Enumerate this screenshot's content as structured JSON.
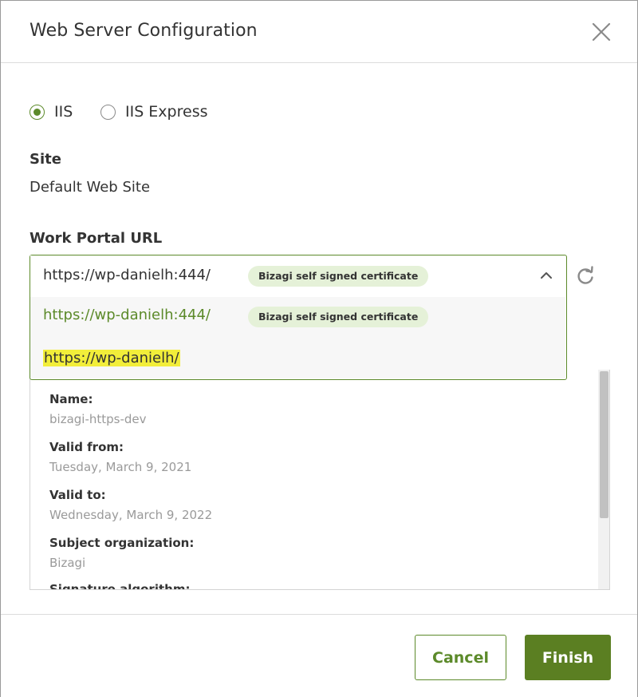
{
  "dialog": {
    "title": "Web Server Configuration"
  },
  "server_type": {
    "options": [
      {
        "label": "IIS",
        "selected": true
      },
      {
        "label": "IIS Express",
        "selected": false
      }
    ]
  },
  "site": {
    "label": "Site",
    "value": "Default Web Site"
  },
  "work_portal": {
    "label": "Work Portal URL",
    "selected_url": "https://wp-danielh:444/",
    "selected_badge": "Bizagi self signed certificate",
    "options": [
      {
        "url": "https://wp-danielh:444/",
        "badge": "Bizagi self signed certificate"
      },
      {
        "url": "https://wp-danielh/",
        "badge": ""
      }
    ]
  },
  "certificate": {
    "fields": [
      {
        "key": "Name:",
        "value": "bizagi-https-dev"
      },
      {
        "key": "Valid from:",
        "value": "Tuesday, March 9, 2021"
      },
      {
        "key": "Valid to:",
        "value": "Wednesday, March 9, 2022"
      },
      {
        "key": "Subject organization:",
        "value": "Bizagi"
      },
      {
        "key": "Signature algorithm:",
        "value": ""
      }
    ]
  },
  "footer": {
    "cancel_label": "Cancel",
    "finish_label": "Finish"
  },
  "colors": {
    "accent": "#5c8a2a",
    "primary_button": "#5b7f22",
    "badge_bg": "#e5f1d8",
    "highlight": "#f2ee3a"
  },
  "icons": {
    "close": "close-icon",
    "refresh": "refresh-icon",
    "chevron": "chevron-up-icon"
  }
}
